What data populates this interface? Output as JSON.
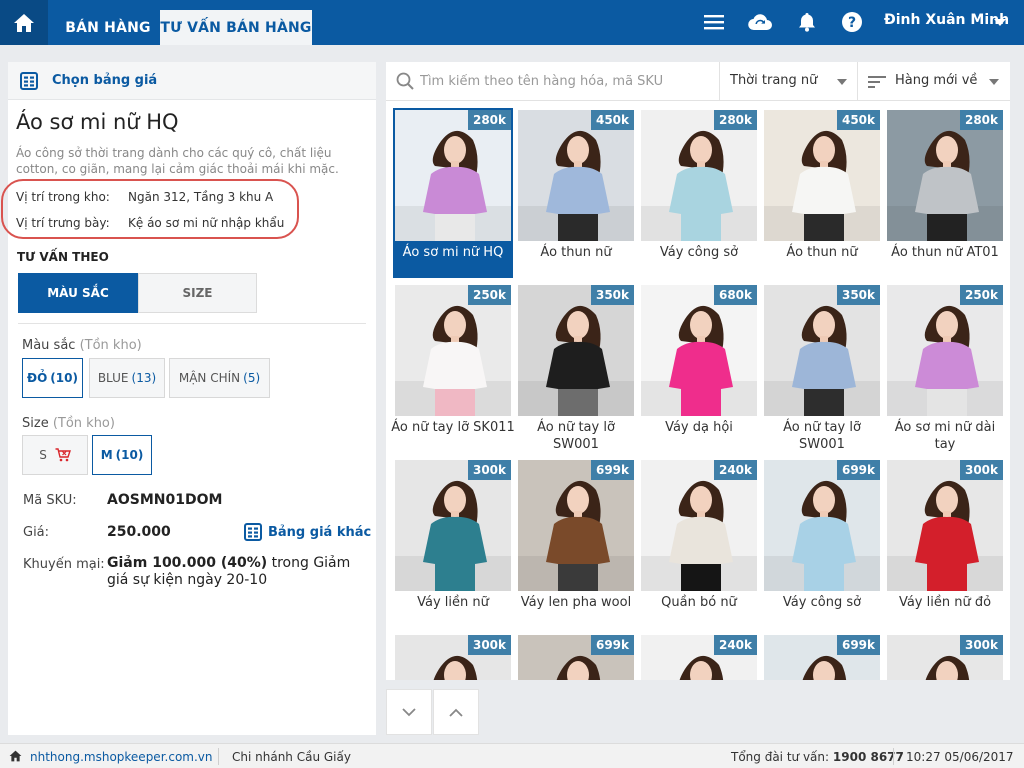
{
  "topbar": {
    "tabs": [
      "BÁN HÀNG",
      "TƯ VẤN BÁN HÀNG"
    ],
    "user_name": "Đinh Xuân Minh",
    "colors": {
      "bar": "#0b5aa2",
      "active_tab": "#f2f4f6"
    }
  },
  "left": {
    "price_table_link": "Chọn bảng giá",
    "product_title": "Áo sơ mi nữ HQ",
    "description": "Áo công sở thời trang dành cho các quý cô, chất liệu cotton, co giãn, mang lại cảm giác thoải mái khi mặc.",
    "warehouse_label": "Vị trí trong kho:",
    "warehouse_value": "Ngăn 312, Tầng 3 khu A",
    "display_label": "Vị trí trưng bày:",
    "display_value": "Kệ áo sơ mi nữ nhập khẩu",
    "consult_title": "TƯ VẤN THEO",
    "seg_color": "MÀU SẮC",
    "seg_size": "SIZE",
    "color_label": "Màu sắc",
    "stock_hint": "(Tồn kho)",
    "colors": [
      {
        "name": "ĐỎ",
        "count": "(10)"
      },
      {
        "name": "BLUE",
        "count": "(13)"
      },
      {
        "name": "MẬN CHÍN",
        "count": "(5)"
      }
    ],
    "size_label": "Size",
    "sizes": [
      {
        "name": "S",
        "count": ""
      },
      {
        "name": "M",
        "count": "(10)"
      }
    ],
    "sku_label": "Mã SKU:",
    "sku_value": "AOSMN01DOM",
    "price_label": "Giá:",
    "price_value": "250.000",
    "other_prices": "Bảng giá khác",
    "promo_label": "Khuyến mại:",
    "promo_bold": "Giảm 100.000 (40%)",
    "promo_rest": " trong Giảm giá sự kiện ngày 20-10"
  },
  "right": {
    "search_placeholder": "Tìm kiếm theo tên hàng hóa, mã SKU",
    "category": "Thời trang nữ",
    "sort": "Hàng mới về",
    "products": [
      {
        "name": "Áo sơ mi nữ HQ",
        "price": "280k",
        "shirt": "#c98ad6",
        "bg": "#e9eef3",
        "bottom": "#e8e8e8",
        "selected": true
      },
      {
        "name": "Áo thun nữ",
        "price": "450k",
        "shirt": "#9fb8db",
        "bg": "#d9dde2",
        "bottom": "#2a2a2a"
      },
      {
        "name": "Váy công sở",
        "price": "280k",
        "shirt": "#a9d4e0",
        "bg": "#f0f0f0",
        "bottom": "#a9d4e0"
      },
      {
        "name": "Áo thun nữ",
        "price": "450k",
        "shirt": "#f6f6f4",
        "bg": "#ece7de",
        "bottom": "#2a2a2a"
      },
      {
        "name": "Áo thun nữ AT01",
        "price": "280k",
        "shirt": "#bfc3c7",
        "bg": "#8c9aa3",
        "bottom": "#222222"
      },
      {
        "name": "Áo nữ tay lỡ SK011",
        "price": "250k",
        "shirt": "#f8f6f6",
        "bg": "#eaeaea",
        "bottom": "#f0b8c4"
      },
      {
        "name": "Áo nữ tay lỡ SW001",
        "price": "350k",
        "shirt": "#1e1e1e",
        "bg": "#d6d6d6",
        "bottom": "#6d6d6d"
      },
      {
        "name": "Váy dạ hội",
        "price": "680k",
        "shirt": "#ef2d8c",
        "bg": "#f4f4f4",
        "bottom": "#ef2d8c"
      },
      {
        "name": "Áo nữ tay lỡ SW001",
        "price": "350k",
        "shirt": "#9db6d8",
        "bg": "#e3e3e3",
        "bottom": "#2d2d2d"
      },
      {
        "name": "Áo sơ mi nữ dài tay",
        "price": "250k",
        "shirt": "#cc8bd7",
        "bg": "#e9e9ea",
        "bottom": "#e4e4e4"
      },
      {
        "name": "Váy liền nữ",
        "price": "300k",
        "shirt": "#2d7f8f",
        "bg": "#e6e6e6",
        "bottom": "#2d7f8f"
      },
      {
        "name": "Váy len pha wool",
        "price": "699k",
        "shirt": "#7a4a2a",
        "bg": "#c9c3bb",
        "bottom": "#3a3a3a"
      },
      {
        "name": "Quần bó nữ",
        "price": "240k",
        "shirt": "#e9e4dc",
        "bg": "#f1f1f1",
        "bottom": "#151515"
      },
      {
        "name": "Váy công sở",
        "price": "699k",
        "shirt": "#a8d1e6",
        "bg": "#dfe6ea",
        "bottom": "#a8d1e6"
      },
      {
        "name": "Váy liền nữ đỏ",
        "price": "300k",
        "shirt": "#d31f2b",
        "bg": "#e7e7e7",
        "bottom": "#d31f2b"
      },
      {
        "name": "",
        "price": "300k",
        "shirt": "#2d7f8f",
        "bg": "#e6e6e6",
        "bottom": "#2d7f8f"
      },
      {
        "name": "",
        "price": "699k",
        "shirt": "#7a4a2a",
        "bg": "#c9c3bb",
        "bottom": "#3a3a3a"
      },
      {
        "name": "",
        "price": "240k",
        "shirt": "#e9e4dc",
        "bg": "#f1f1f1",
        "bottom": "#151515"
      },
      {
        "name": "",
        "price": "699k",
        "shirt": "#a8d1e6",
        "bg": "#dfe6ea",
        "bottom": "#a8d1e6"
      },
      {
        "name": "",
        "price": "300k",
        "shirt": "#d31f2b",
        "bg": "#e7e7e7",
        "bottom": "#d31f2b"
      }
    ]
  },
  "footer": {
    "site": "nhthong.mshopkeeper.com.vn",
    "branch": "Chi nhánh Cầu Giấy",
    "hotline_label": "Tổng đài tư vấn:",
    "hotline": "1900 8677",
    "datetime": "10:27 05/06/2017"
  }
}
